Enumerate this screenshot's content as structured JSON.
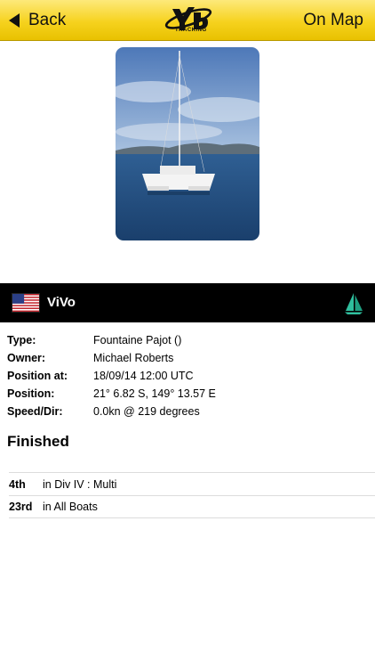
{
  "navbar": {
    "back_label": "Back",
    "map_label": "On Map",
    "logo_text": "TRACKING"
  },
  "boat": {
    "name": "ViVo",
    "flag": "us-flag-icon"
  },
  "details": [
    {
      "label": "Type:",
      "value": "Fountaine Pajot ()"
    },
    {
      "label": "Owner:",
      "value": "Michael Roberts"
    },
    {
      "label": "Position at:",
      "value": "18/09/14 12:00 UTC"
    },
    {
      "label": "Position:",
      "value": "21° 6.82 S, 149° 13.57 E"
    },
    {
      "label": "Speed/Dir:",
      "value": "0.0kn @ 219 degrees"
    }
  ],
  "status": "Finished",
  "rankings": [
    {
      "position": "4th",
      "text": "in Div IV : Multi"
    },
    {
      "position": "23rd",
      "text": "in All Boats"
    }
  ],
  "colors": {
    "navbar": "#f6d21e",
    "header_bar": "#000000",
    "sail_icon": "#2fbf9e"
  }
}
